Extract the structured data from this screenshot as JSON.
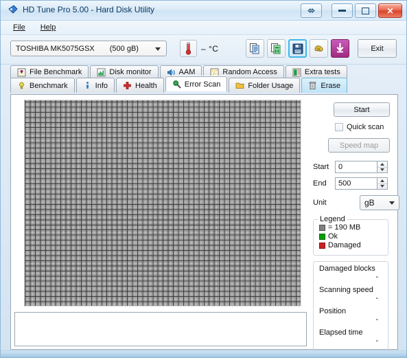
{
  "window": {
    "title": "HD Tune Pro 5.00 - Hard Disk Utility",
    "icon": "hdtune-logo-icon",
    "buttons": {
      "resize": "resize-arrows-icon",
      "minimize": "minimize-icon",
      "maximize": "maximize-icon",
      "close": "✕"
    }
  },
  "menu": {
    "items": [
      {
        "label": "File",
        "mnemonic": "F"
      },
      {
        "label": "Help",
        "mnemonic": "H"
      }
    ]
  },
  "toolbar": {
    "drive": {
      "name": "TOSHIBA MK5075GSX",
      "capacity": "(500 gB)"
    },
    "temperature": {
      "icon": "thermometer-icon",
      "value": "–  °C"
    },
    "buttons": [
      {
        "name": "copy-icon",
        "title": "Copy"
      },
      {
        "name": "copy-to-excel-icon",
        "title": "Copy to spreadsheet"
      },
      {
        "name": "save-icon",
        "title": "Save",
        "selected": true
      },
      {
        "name": "settings-icon",
        "title": "Options"
      },
      {
        "name": "download-icon",
        "title": "Download"
      }
    ],
    "exit_label": "Exit"
  },
  "tabs": {
    "row1": [
      {
        "label": "File Benchmark",
        "icon": "file-benchmark-icon",
        "state": "normal"
      },
      {
        "label": "Disk monitor",
        "icon": "disk-monitor-icon",
        "state": "normal"
      },
      {
        "label": "AAM",
        "icon": "speaker-icon",
        "state": "normal"
      },
      {
        "label": "Random Access",
        "icon": "random-access-icon",
        "state": "normal"
      },
      {
        "label": "Extra tests",
        "icon": "extra-tests-icon",
        "state": "normal"
      }
    ],
    "row2": [
      {
        "label": "Benchmark",
        "icon": "lightbulb-icon",
        "state": "normal"
      },
      {
        "label": "Info",
        "icon": "info-icon",
        "state": "normal"
      },
      {
        "label": "Health",
        "icon": "health-cross-icon",
        "state": "normal"
      },
      {
        "label": "Error Scan",
        "icon": "magnifier-icon",
        "state": "active"
      },
      {
        "label": "Folder Usage",
        "icon": "folder-icon",
        "state": "normal"
      },
      {
        "label": "Erase",
        "icon": "trash-icon",
        "state": "highlighted"
      }
    ]
  },
  "error_scan": {
    "start_button": "Start",
    "quick_scan": {
      "label": "Quick scan",
      "checked": false
    },
    "speed_map_button": "Speed map",
    "fields": [
      {
        "label": "Start",
        "value": "0"
      },
      {
        "label": "End",
        "value": "500"
      }
    ],
    "unit": {
      "label": "Unit",
      "value": "gB"
    },
    "legend": {
      "title": "Legend",
      "block_size": "=  190 MB",
      "ok_label": "Ok",
      "damaged_label": "Damaged",
      "block_color": "#808080",
      "ok_color": "#00a000",
      "damaged_color": "#cc2020"
    },
    "stats": [
      {
        "label": "Damaged blocks",
        "value": "-"
      },
      {
        "label": "Scanning speed",
        "value": "-"
      },
      {
        "label": "Position",
        "value": "-"
      },
      {
        "label": "Elapsed time",
        "value": "-"
      }
    ],
    "log_text": ""
  }
}
